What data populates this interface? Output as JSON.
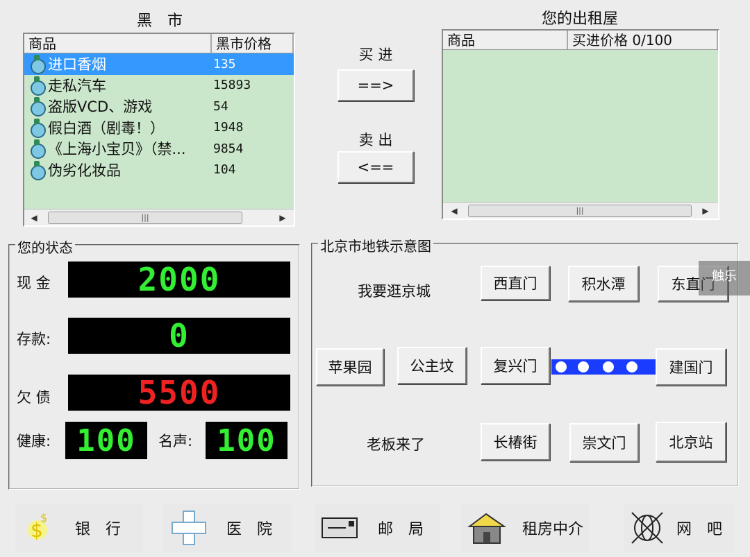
{
  "black_market": {
    "title": "黑　市",
    "columns": [
      "商品",
      "黑市价格"
    ],
    "items": [
      {
        "name": "进口香烟",
        "price": "135"
      },
      {
        "name": "走私汽车",
        "price": "15893"
      },
      {
        "name": "盗版VCD、游戏",
        "price": "54"
      },
      {
        "name": "假白酒（剧毒！）",
        "price": "1948"
      },
      {
        "name": "《上海小宝贝》（禁...",
        "price": "9854"
      },
      {
        "name": "伪劣化妆品",
        "price": "104"
      }
    ],
    "selected_index": 0
  },
  "rental": {
    "title": "您的出租屋",
    "columns": [
      "商品",
      "买进价格 0/100"
    ]
  },
  "trade": {
    "buy_label": "买 进",
    "buy_button": "==>",
    "sell_label": "卖 出",
    "sell_button": "<=="
  },
  "status": {
    "title": "您的状态",
    "cash_label": "现 金",
    "cash": "2000",
    "deposit_label": "存款:",
    "deposit": "0",
    "debt_label": "欠 债",
    "debt": "5500",
    "health_label": "健康:",
    "health": "100",
    "fame_label": "名声:",
    "fame": "100"
  },
  "subway": {
    "title": "北京市地铁示意图",
    "stroll_label": "我要逛京城",
    "boss_label": "老板来了",
    "stations": {
      "xizhimen": "西直门",
      "jishuitan": "积水潭",
      "dongzhimen": "东直门",
      "pingguoyuan": "苹果园",
      "gongzhufen": "公主坟",
      "fuxingmen": "复兴门",
      "jianguomen": "建国门",
      "changchunjie": "长椿街",
      "chongwenmen": "崇文门",
      "beijingzhan": "北京站"
    }
  },
  "bottom": {
    "bank": "银　行",
    "hospital": "医　院",
    "post": "邮　局",
    "agency": "租房中介",
    "netbar": "网　吧"
  },
  "watermark": "触乐"
}
